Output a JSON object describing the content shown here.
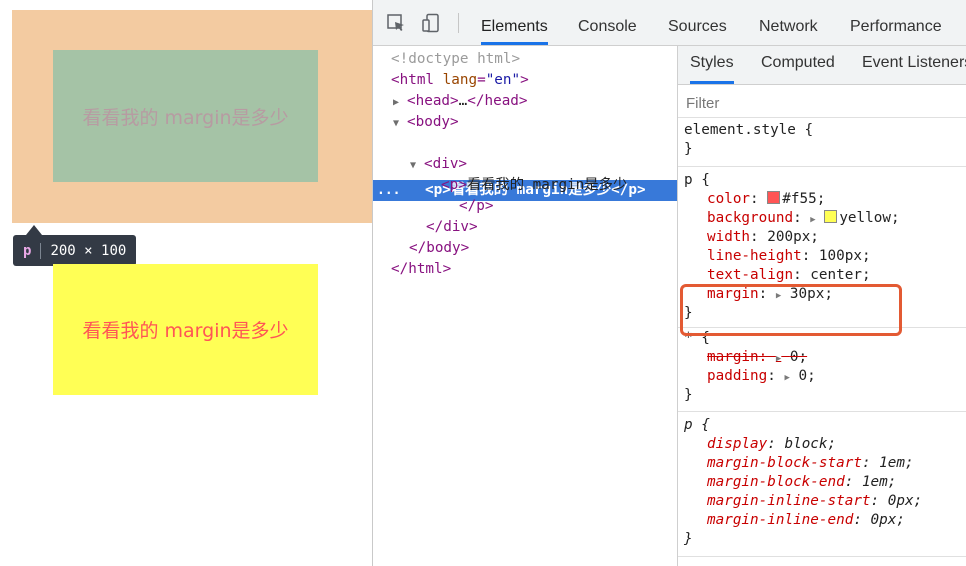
{
  "preview": {
    "highlighted_text": "看看我的 margin是多少",
    "tooltip": {
      "tag": "p",
      "size": "200 × 100"
    },
    "yellow_text": "看看我的 margin是多少"
  },
  "devtools": {
    "tabs": [
      "Elements",
      "Console",
      "Sources",
      "Network",
      "Performance"
    ],
    "active_tab": "Elements",
    "dom": {
      "doctype": "<!doctype html>",
      "html_open_tag": "<html",
      "html_attr_name": "lang",
      "html_attr_value": "\"en\"",
      "html_open_close": ">",
      "head": "<head>",
      "head_ellipsis": "…",
      "head_close": "</head>",
      "body_open": "<body>",
      "selected_row": "<p>看看我的 margin是多少</p>",
      "selected_dots": "...",
      "div_open": "<div>",
      "inner_p_open": "<p>",
      "inner_p_text": "看看我的 margin是多少",
      "inner_p_close": "</p>",
      "div_close": "</div>",
      "body_close": "</body>",
      "html_close": "</html>"
    },
    "styles": {
      "tabs": [
        "Styles",
        "Computed",
        "Event Listeners"
      ],
      "active_tab": "Styles",
      "filter_placeholder": "Filter",
      "element_style_selector": "element.style {",
      "element_style_close": "}",
      "rule1": {
        "selector": "p {",
        "color_name": "color",
        "color_value": "#f55;",
        "color_swatch": "#ff5555",
        "background_name": "background",
        "background_value": "yellow;",
        "background_swatch": "#ffff55",
        "width_name": "width",
        "width_value": "200px;",
        "line_height_name": "line-height",
        "line_height_value": "100px;",
        "text_align_name": "text-align",
        "text_align_value": "center;",
        "margin_name": "margin",
        "margin_value": "30px;",
        "close": "}"
      },
      "rule2": {
        "selector": "* {",
        "margin_name": "margin",
        "margin_value": "0;",
        "padding_name": "padding",
        "padding_value": "0;",
        "close": "}"
      },
      "rule3": {
        "selector": "p {",
        "display_name": "display",
        "display_value": "block;",
        "mbs_name": "margin-block-start",
        "mbs_value": "1em;",
        "mbe_name": "margin-block-end",
        "mbe_value": "1em;",
        "mis_name": "margin-inline-start",
        "mis_value": "0px;",
        "mie_name": "margin-inline-end",
        "mie_value": "0px;",
        "close": "}"
      }
    },
    "colors": {
      "selection_blue": "#3879d9",
      "highlight_red": "#e35a33",
      "margin_overlay": "#f3cba1",
      "content_overlay": "#a5c3a6"
    }
  }
}
